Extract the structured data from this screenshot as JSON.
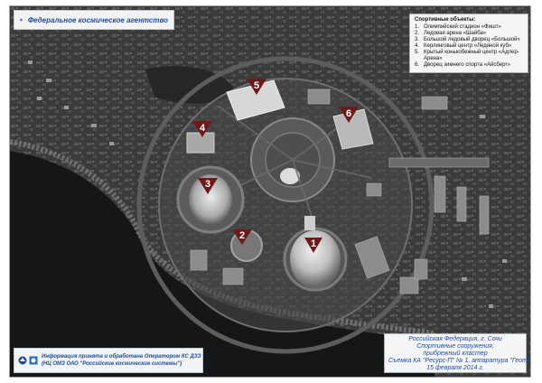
{
  "header": {
    "agency": "Федеральное космическое агентство"
  },
  "legend": {
    "title": "Спортивные объекты:",
    "items": [
      {
        "num": "1.",
        "label": "Олимпийский стадион «Фишт»"
      },
      {
        "num": "2.",
        "label": "Ледовая арена «Шайба»"
      },
      {
        "num": "3.",
        "label": "Большой ледовый дворец «Большой»"
      },
      {
        "num": "4.",
        "label": "Керлинговый центр «Ледяной куб»"
      },
      {
        "num": "5.",
        "label": "Крытый конькобежный центр «Адлер-Арена»"
      },
      {
        "num": "6.",
        "label": "Дворец зимнего спорта «Айсберг»"
      }
    ]
  },
  "markers": [
    "1",
    "2",
    "3",
    "4",
    "5",
    "6"
  ],
  "caption": {
    "line1": "Российская Федерация, г. Сочи",
    "line2": "Спортивные сооружения,",
    "line3": "прибрежный кластер",
    "line4": "Съемка КА \"Ресурс-П\" № 1, аппаратура \"Геотон\"",
    "line5": "15 февраля 2014 г."
  },
  "operator": {
    "line1": "Информация принята и обработана Оператором КС ДЗЗ",
    "line2": "(НЦ ОМЗ ОАО \"Российские космические системы\")"
  },
  "colors": {
    "marker": "#6b1b1b",
    "caption_text": "#1f4b9a",
    "sea": "#141618"
  }
}
